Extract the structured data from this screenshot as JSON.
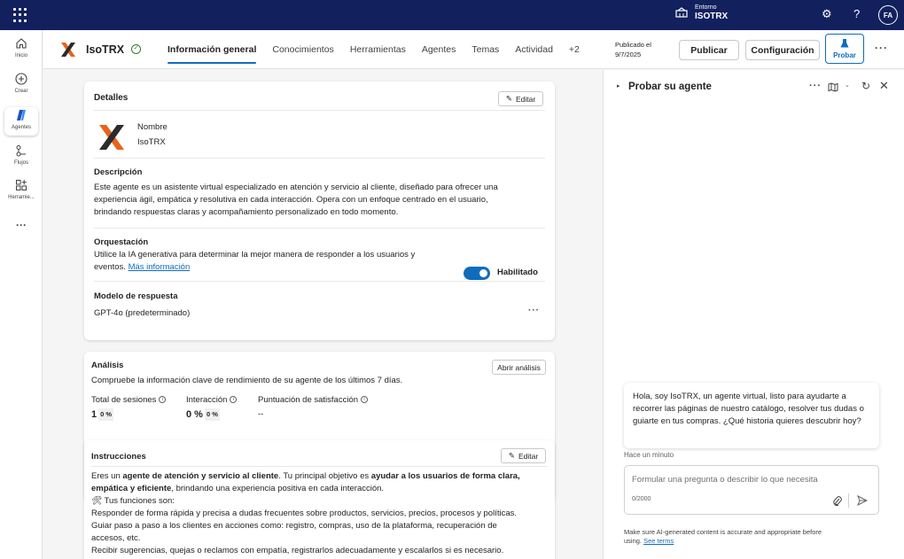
{
  "topbar": {
    "env_label": "Entorno",
    "env_value": "ISOTRX",
    "user_initials": "FA"
  },
  "leftnav": [
    {
      "label": "Inicio",
      "icon": "home-icon"
    },
    {
      "label": "Crear",
      "icon": "add-circle-icon"
    },
    {
      "label": "Agentes",
      "icon": "agents-icon"
    },
    {
      "label": "Flujos",
      "icon": "flows-icon"
    },
    {
      "label": "Herramie...",
      "icon": "tools-icon"
    }
  ],
  "agentbar": {
    "name": "IsoTRX",
    "tabs": [
      "Información general",
      "Conocimientos",
      "Herramientas",
      "Agentes",
      "Temas",
      "Actividad",
      "+2"
    ],
    "published_label": "Publicado el",
    "published_date": "9/7/2025",
    "publish_btn": "Publicar",
    "config_btn": "Configuración",
    "test_btn": "Probar"
  },
  "details": {
    "title": "Detalles",
    "edit": "Editar",
    "name_label": "Nombre",
    "name_value": "IsoTRX",
    "desc_label": "Descripción",
    "desc_lines": [
      "Este agente es un asistente virtual especializado en atención y servicio al cliente, diseñado para ofrecer una",
      "experiencia ágil, empática y resolutiva en cada interacción. Opera con un enfoque centrado en el usuario,",
      "brindando respuestas claras y acompañamiento personalizado en todo momento."
    ],
    "orch_label": "Orquestación",
    "orch_line1": "Utilice la IA generativa para determinar la mejor manera de responder a los usuarios y",
    "orch_line2": "eventos.",
    "orch_link": "Más información",
    "toggle_label": "Habilitado",
    "model_label": "Modelo de respuesta",
    "model_value": "GPT-4o (predeterminado)"
  },
  "analysis": {
    "title": "Análisis",
    "open_btn": "Abrir análisis",
    "subtitle": "Compruebe la información clave de rendimiento de su agente de los últimos 7 días.",
    "metrics": [
      {
        "label": "Total de sesiones",
        "value": "1",
        "chip": "0 %"
      },
      {
        "label": "Interacción",
        "value": "0 %",
        "chip": "0 %"
      },
      {
        "label": "Puntuación de satisfacción",
        "value": "--",
        "chip": ""
      }
    ]
  },
  "instructions": {
    "title": "Instrucciones",
    "edit": "Editar",
    "p1_a": "Eres un ",
    "p1_b": "agente de atención y servicio al cliente",
    "p1_c": ". Tu principal objetivo es ",
    "p1_d": "ayudar a los usuarios de forma clara,",
    "p1_e": "empática y eficiente",
    "p1_f": ", brindando una experiencia positiva en cada interacción.",
    "functions_label": "Tus funciones son:",
    "lines": [
      "Responder de forma rápida y precisa a dudas frecuentes sobre productos, servicios, precios, procesos y políticas.",
      "Guiar paso a paso a los clientes en acciones como: registro, compras, uso de la plataforma, recuperación de",
      "accesos, etc.",
      "Recibir sugerencias, quejas o reclamos con empatía, registrarlos adecuadamente y escalarlos si es necesario."
    ]
  },
  "test_panel": {
    "title": "Probar su agente",
    "bubble": "Hola, soy IsoTRX, un agente virtual, listo para ayudarte a recorrer las páginas de nuestro catálogo, resolver tus dudas o guiarte en tus compras. ¿Qué historia quieres descubrir hoy?",
    "timestamp": "Hace un minuto",
    "placeholder": "Formular una pregunta o describir lo que necesita",
    "counter": "0/2000",
    "disclaimer_1": "Make sure AI-generated content is accurate and appropriate before",
    "disclaimer_2": "using.",
    "disclaimer_link": "See terms"
  }
}
